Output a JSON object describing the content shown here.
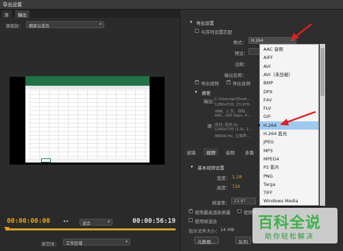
{
  "window": {
    "title": "导出设置"
  },
  "left_panel": {
    "tabs": [
      "源",
      "输出"
    ],
    "scale_label": "源缩放：",
    "scale_value": "缩放以适合",
    "timecode_in": "00:00:00:00",
    "timecode_out": "00:00:56:19",
    "fit_value": "适合",
    "source_range_label": "源范围：",
    "source_range_value": "工作区域"
  },
  "right_panel": {
    "section_title": "导出设置",
    "match_sequence_label": "与序列设置匹配",
    "format_label": "格式：",
    "format_value": "H.264",
    "preset_label": "预设：",
    "comment_label": "注释：",
    "output_name_label": "输出名称：",
    "export_video_label": "导出视频",
    "export_audio_label": "导出音频",
    "summary_title": "摘要",
    "output_label": "输出：",
    "output_lines": [
      "C:\\Users\\pc\\Desk...",
      "1280x720, 23.976...",
      "VBR，1 次，目标...",
      "AAC, 160 kbps, 4..."
    ],
    "source_label": "源：",
    "source_lines": [
      "序列, 序列 01",
      "1280x720 (1.0), 2...",
      "48000 Hz, 立体声..."
    ],
    "tabs": [
      "滤镜",
      "视频",
      "音频",
      "多路"
    ],
    "basic_video_settings": "基本视频设置",
    "width_label": "宽度：",
    "width_value": "1,28",
    "height_label": "高度：",
    "height_value": "720",
    "frame_rate_label": "帧速率：",
    "frame_rate_value": "23.97",
    "max_render_label": "使用最高渲染质量",
    "use_preview_label": "使用预览",
    "use_frame_blend_label": "使用帧混合",
    "file_size_label": "估计文件大小：",
    "file_size_value": "14 MB",
    "metadata_button": "元数据...",
    "queue_button": "队列"
  },
  "format_dropdown": {
    "options": [
      "AAC 音频",
      "AIFF",
      "AVI",
      "AVI（未压缩）",
      "BMP",
      "DPX",
      "F4V",
      "FLV",
      "GIF",
      "H.264",
      "H.264 蓝光",
      "JPEG",
      "MP3",
      "MPEG4",
      "P2 影片",
      "PNG",
      "Targa",
      "TIFF",
      "Windows Media"
    ],
    "selected": "H.264"
  },
  "watermark": {
    "main": "百科全说",
    "sub": "助你轻松解决"
  },
  "colors": {
    "accent_orange": "#e8a316",
    "selection_blue": "#9fc9ef",
    "arrow_red": "#e02020",
    "watermark_green": "#3eb149"
  }
}
